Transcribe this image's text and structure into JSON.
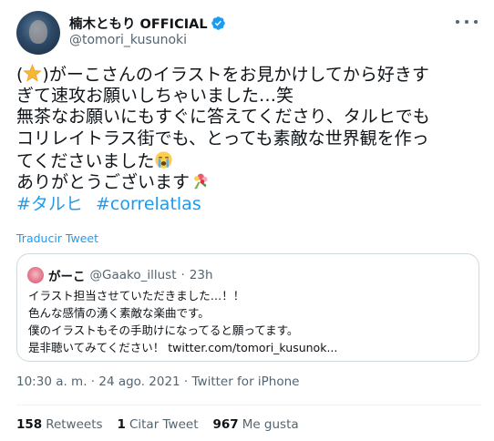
{
  "author": {
    "display_name": "楠木ともり OFFICIAL",
    "handle": "@tomori_kusunoki"
  },
  "tweet": {
    "lines": [
      {
        "pre": "(",
        "emoji": "star-emoji",
        "post": ")がーこさんのイラストをお見かけしてから好きす"
      },
      {
        "text": "ぎて速攻お願いしちゃいました…笑"
      },
      {
        "text": "無茶なお願いにもすぐに答えてくださり、タルヒでも"
      },
      {
        "text": "コリレイトラス街でも、とっても素敵な世界観を作っ"
      },
      {
        "pre": "てくださいました",
        "emoji": "crying-face-emoji",
        "post": ""
      },
      {
        "pre": "ありがとうございます",
        "emoji": "bouquet-emoji",
        "post": ""
      }
    ],
    "hashtags": [
      "#タルヒ",
      "#correlatlas"
    ]
  },
  "translate_label": "Traducir Tweet",
  "quote": {
    "name": "がーこ",
    "handle": "@Gaako_illust",
    "dot": "·",
    "time": "23h",
    "lines": [
      "イラスト担当させていただきました…！！",
      "色んな感情の湧く素敵な楽曲です。",
      "僕のイラストもその手助けになってると願ってます。",
      "是非聴いてみてください！ twitter.com/tomori_kusunok..."
    ]
  },
  "meta": "10:30 a. m. · 24 ago. 2021 · Twitter for iPhone",
  "stats": [
    {
      "count": "158",
      "label": "Retweets"
    },
    {
      "count": "1",
      "label": "Citar Tweet"
    },
    {
      "count": "967",
      "label": "Me gusta"
    }
  ],
  "colors": {
    "accent": "#1d9bf0",
    "secondary_text": "#536471",
    "border": "#cfd9de"
  }
}
